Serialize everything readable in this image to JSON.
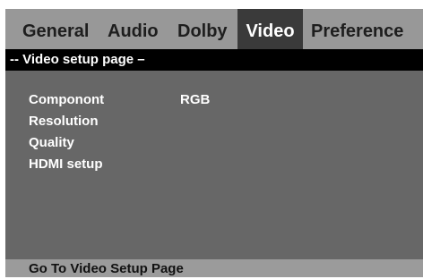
{
  "tabs": [
    {
      "label": "General",
      "active": false
    },
    {
      "label": "Audio",
      "active": false
    },
    {
      "label": "Dolby",
      "active": false
    },
    {
      "label": "Video",
      "active": true
    },
    {
      "label": "Preference",
      "active": false
    }
  ],
  "page_title": "-- Video setup page –",
  "menu": [
    {
      "label": "Componont",
      "value": "RGB"
    },
    {
      "label": "Resolution",
      "value": ""
    },
    {
      "label": "Quality",
      "value": ""
    },
    {
      "label": "HDMI setup",
      "value": ""
    }
  ],
  "status": "Go To Video Setup Page",
  "colors": {
    "tabbar_bg": "#989898",
    "active_tab_bg": "#3a3a3a",
    "panel_bg": "#676767",
    "title_bar_bg": "#000000",
    "footer_bg": "#9b9b9b"
  }
}
